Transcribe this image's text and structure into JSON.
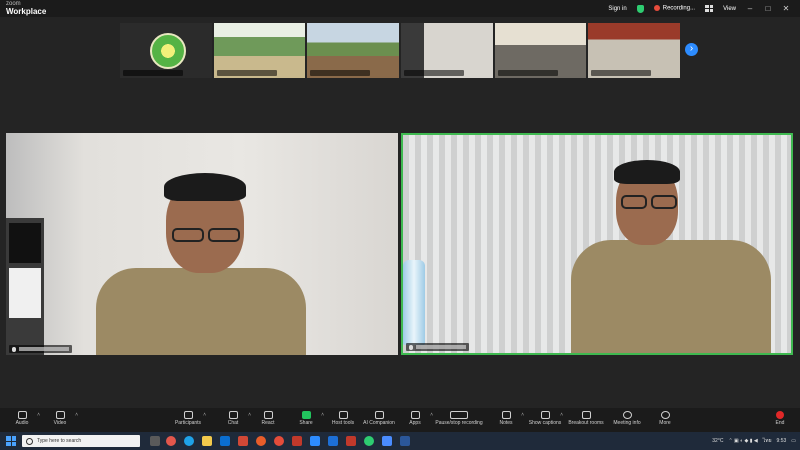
{
  "app": {
    "brand_small": "zoom",
    "brand": "Workplace"
  },
  "titlebar": {
    "signin": "Sign in",
    "recording": "Recording...",
    "view": "View"
  },
  "strip": {
    "thumbs": [
      {
        "name": ""
      },
      {
        "name": ""
      },
      {
        "name": ""
      },
      {
        "name": ""
      },
      {
        "name": ""
      },
      {
        "name": ""
      }
    ]
  },
  "tiles": {
    "left_name": "",
    "right_name": ""
  },
  "toolbar": {
    "audio": "Audio",
    "video": "Video",
    "participants": "Participants",
    "chat": "Chat",
    "react": "React",
    "share": "Share",
    "host_tools": "Host tools",
    "ai": "AI Companion",
    "apps": "Apps",
    "pause": "Pause/stop recording",
    "notes": "Notes",
    "captions": "Show captions",
    "breakout": "Breakout rooms",
    "meeting_info": "Meeting info",
    "more": "More",
    "end": "End"
  },
  "taskbar": {
    "search_placeholder": "Type here to search",
    "temp": "32°C",
    "time": "9:53",
    "lang": "ไทย"
  },
  "colors": {
    "accent": "#2d8cff",
    "speaker_border": "#3fb950",
    "end": "#e02828",
    "share": "#22c55e"
  }
}
